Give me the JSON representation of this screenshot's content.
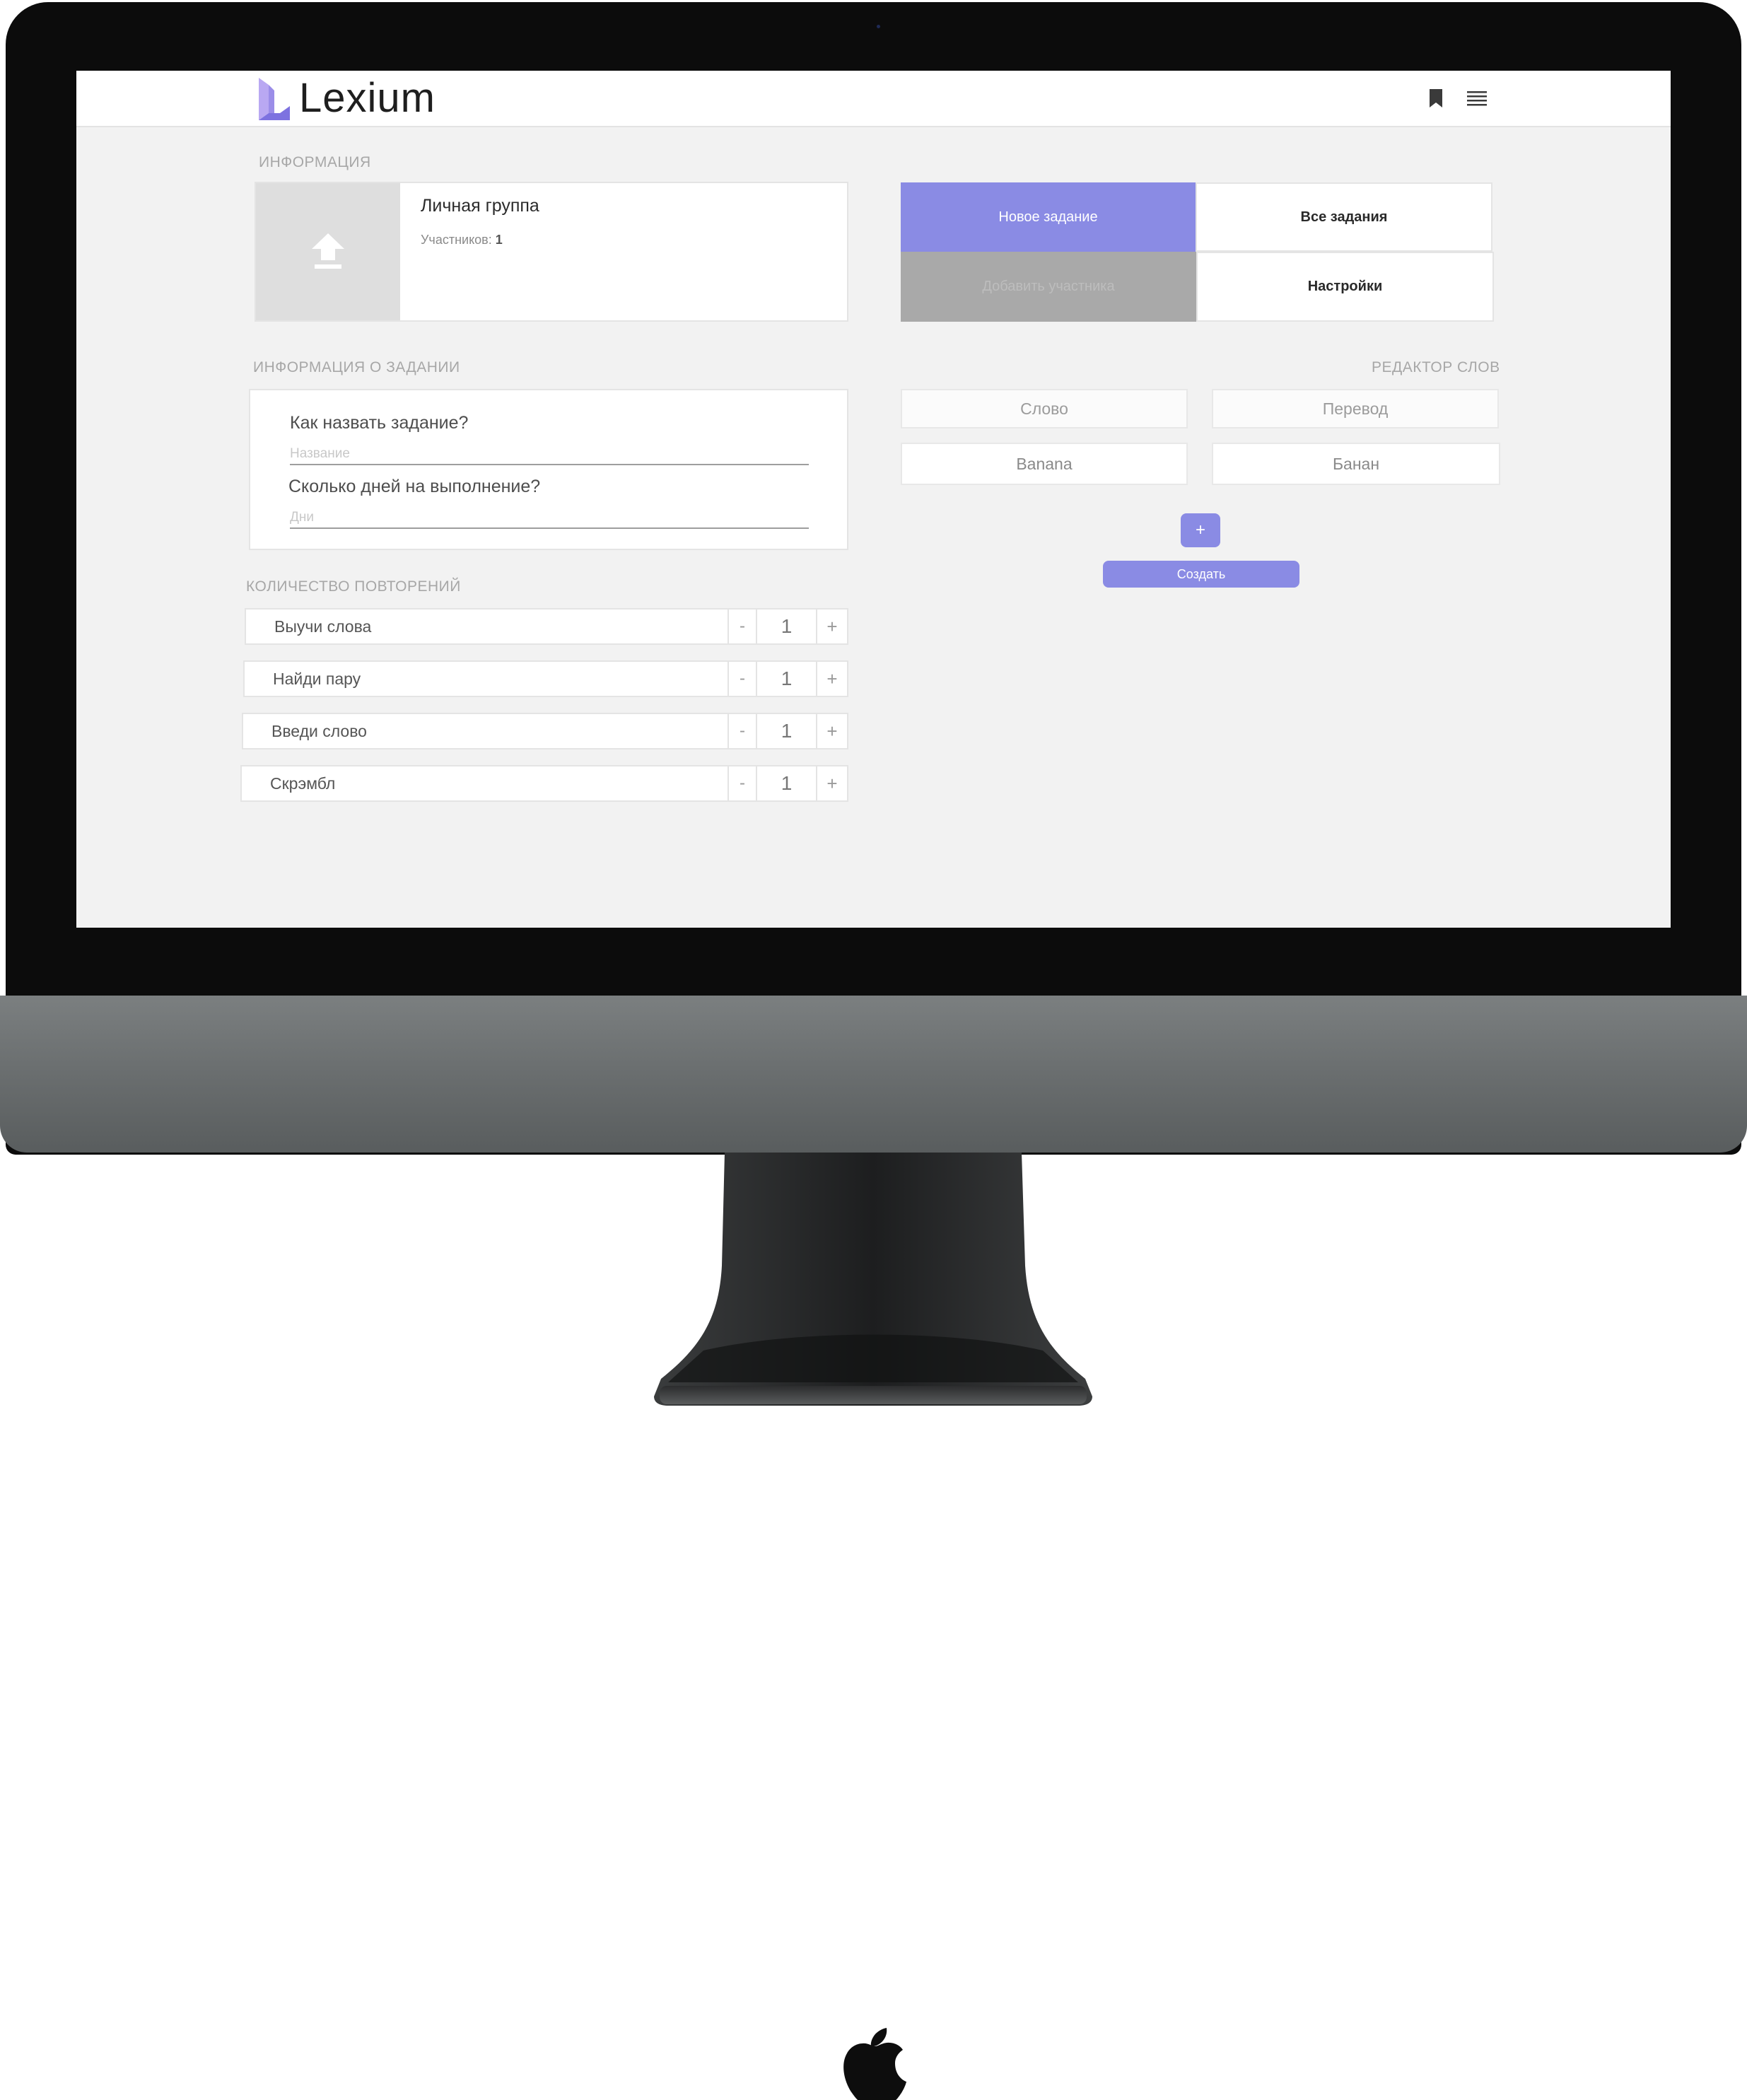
{
  "app": {
    "brand": "Lexium",
    "accent_color": "#8a8be4",
    "icons": {
      "logo": "lexium-logo-icon",
      "bookmark": "bookmark-icon",
      "menu": "menu-icon",
      "upload": "upload-icon"
    }
  },
  "info": {
    "section_title": "ИНФОРМАЦИЯ",
    "group_name": "Личная группа",
    "members_label": "Участников:",
    "members_count": "1"
  },
  "actions": {
    "new_task": "Новое задание",
    "all_tasks": "Все задания",
    "add_member": "Добавить участника",
    "settings": "Настройки"
  },
  "task_info": {
    "section_title": "ИНФОРМАЦИЯ О ЗАДАНИИ",
    "name_question": "Как назвать задание?",
    "name_placeholder": "Название",
    "days_question": "Сколько дней на выполнение?",
    "days_placeholder": "Дни"
  },
  "repetitions": {
    "section_title": "КОЛИЧЕСТВО ПОВТОРЕНИЙ",
    "items": [
      {
        "label": "Выучи слова",
        "minus": "-",
        "count": "1",
        "plus": "+"
      },
      {
        "label": "Найди пару",
        "minus": "-",
        "count": "1",
        "plus": "+"
      },
      {
        "label": "Введи слово",
        "minus": "-",
        "count": "1",
        "plus": "+"
      },
      {
        "label": "Скрэмбл",
        "minus": "-",
        "count": "1",
        "plus": "+"
      }
    ]
  },
  "word_editor": {
    "section_title": "РЕДАКТОР СЛОВ",
    "word_header": "Слово",
    "translation_header": "Перевод",
    "rows": [
      {
        "word": "Banana",
        "translation": "Банан"
      }
    ],
    "add_button": "+",
    "create_button": "Создать"
  }
}
